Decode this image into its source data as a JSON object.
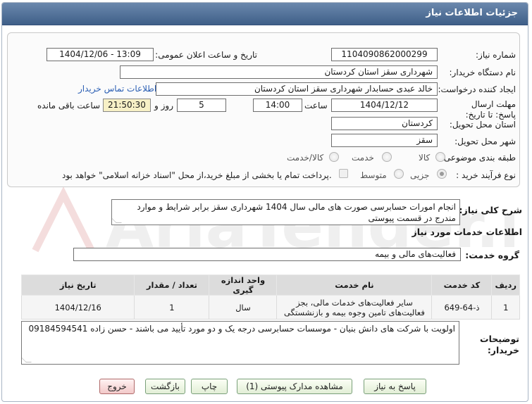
{
  "title": "جزئیات اطلاعات نیاز",
  "fields": {
    "need_number_label": "شماره نیاز:",
    "need_number": "1104090862000299",
    "announce_label": "تاریخ و ساعت اعلان عمومی:",
    "announce_value": "1404/12/06 - 13:09",
    "buyer_org_label": "نام دستگاه خریدار:",
    "buyer_org": "شهرداری سقز استان کردستان",
    "creator_label": "ایجاد کننده درخواست:",
    "creator": "خالد عبدی حسابدار شهرداری سقز استان کردستان",
    "contact_link": "اطلاعات تماس خریدار",
    "deadline_label": "مهلت ارسال پاسخ: تا تاریخ:",
    "deadline_date": "1404/12/12",
    "time_label": "ساعت",
    "deadline_time": "14:00",
    "days_value": "5",
    "days_label": "روز و",
    "remaining_time": "21:50:30",
    "remaining_label": "ساعت باقی مانده",
    "province_label": "استان محل تحویل:",
    "province": "کردستان",
    "city_label": "شهر محل تحویل:",
    "city": "سقز",
    "category_label": "طبقه بندی موضوعی:",
    "category_options": [
      "کالا",
      "خدمت",
      "کالا/خدمت"
    ],
    "process_label": "نوع فرآیند خرید :",
    "process_options": [
      "جزیی",
      "متوسط"
    ],
    "payment_note": "پرداخت تمام یا بخشی از مبلغ خرید،از محل \"اسناد خزانه اسلامی\" خواهد بود."
  },
  "summary": {
    "label": "شرح کلی نیاز:",
    "text": "انجام امورات حسابرسی صورت های مالی سال 1404 شهرداری سقز برابر شرایط و موارد مندرج در قسمت پیوستی"
  },
  "services": {
    "section_title": "اطلاعات خدمات مورد نیاز",
    "group_label": "گروه خدمت:",
    "group_value": "فعالیت‌های مالی و بیمه",
    "columns": [
      "ردیف",
      "کد خدمت",
      "نام خدمت",
      "واحد اندازه گیری",
      "تعداد / مقدار",
      "تاریخ نیاز"
    ],
    "rows": [
      {
        "index": "1",
        "code": "ذ-64-649",
        "name": "سایر فعالیت‌های خدمات مالی، بجز فعالیت‌های تامین وجوه بیمه و بازنشستگی",
        "unit": "سال",
        "qty": "1",
        "date": "1404/12/16"
      }
    ]
  },
  "notes": {
    "label": "توضیحات خریدار:",
    "text": "اولویت با شرکت های دانش بنیان - موسسات حسابرسی درجه یک و دو مورد تأیید می باشند - حسن زاده 09184594541"
  },
  "buttons": {
    "reply": "پاسخ به نیاز",
    "attachments": "مشاهده مدارک پیوستی (1)",
    "print": "چاپ",
    "back": "بازگشت",
    "exit": "خروج"
  },
  "watermark": "AriaTender.net",
  "colors": {
    "titlebar": "#4a6a93",
    "timer_bg": "#f7f0c6",
    "link": "#2b5fb4",
    "exit_bg": "#f2c9c9"
  }
}
